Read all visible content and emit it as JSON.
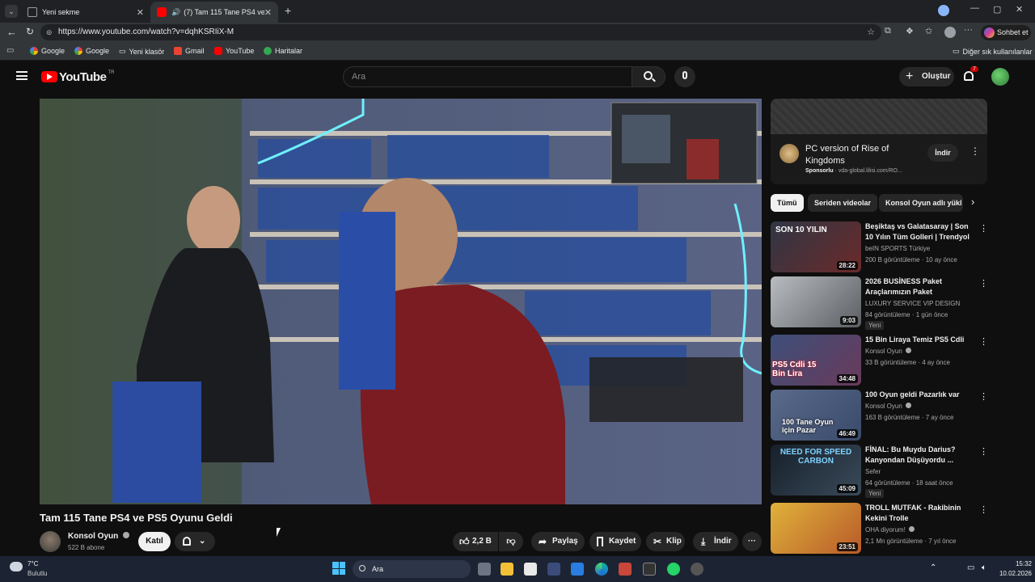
{
  "browser": {
    "tabs": [
      {
        "title": "Yeni sekme"
      },
      {
        "title": "(7) Tam 115 Tane PS4 ve PS5 O"
      }
    ],
    "url": "https://www.youtube.com/watch?v=dqhKSRIiX-M",
    "profile_button": "Sohbet et",
    "bookmarks": [
      "Google",
      "Google",
      "Yeni klasör",
      "Gmail",
      "YouTube",
      "Haritalar"
    ],
    "other_bookmarks": "Diğer sık kullanılanlar"
  },
  "youtube": {
    "logo": "YouTube",
    "logo_region": "TR",
    "search_placeholder": "Ara",
    "create_label": "Oluştur",
    "notification_count": "7"
  },
  "video": {
    "title": "Tam 115 Tane PS4 ve PS5 Oyunu Geldi",
    "channel": "Konsol Oyun",
    "subscribers": "522 B abone",
    "join_label": "Katıl",
    "likes": "2,2 B",
    "share_label": "Paylaş",
    "save_label": "Kaydet",
    "clip_label": "Klip",
    "download_label": "İndir"
  },
  "ad": {
    "title": "PC version of Rise of Kingdoms",
    "sponsored": "Sponsorlu",
    "domain": "· vda-global.lilisi.com/RO...",
    "button": "İndir"
  },
  "chips": [
    "Tümü",
    "Seriden videolar",
    "Konsol Oyun adlı yükl"
  ],
  "recommendations": [
    {
      "title": "Beşiktaş vs Galatasaray | Son 10 Yılın Tüm Golleri | Trendyol ...",
      "channel": "beIN SPORTS Türkiye",
      "meta": "200 B görüntüleme · 10 ay önce",
      "duration": "28:22",
      "badge": "",
      "thumb_color": "#3a3f4a",
      "thumb_text": "SON 10 YILIN"
    },
    {
      "title": "2026 BUSİNESS Paket Araçlarımızın Paket Kapsamla...",
      "channel": "LUXURY SERVICE VIP DESIGN",
      "meta": "84 görüntüleme · 1 gün önce",
      "duration": "9:03",
      "badge": "Yeni",
      "thumb_color": "#8a8d92",
      "thumb_text": ""
    },
    {
      "title": "15 Bin Liraya Temiz PS5 Cdli",
      "channel": "Konsol Oyun",
      "meta": "33 B görüntüleme · 4 ay önce",
      "duration": "34:48",
      "badge": "",
      "thumb_color": "#5a4a6a",
      "thumb_text": "PS5 Cdli 15 Bin Lira"
    },
    {
      "title": "100 Oyun geldi Pazarlık var",
      "channel": "Konsol Oyun",
      "meta": "163 B görüntüleme · 7 ay önce",
      "duration": "46:49",
      "badge": "",
      "thumb_color": "#4a5a7a",
      "thumb_text": "100 Tane Oyun için Pazar"
    },
    {
      "title": "FİNAL: Bu Muydu Darius? Kanyondan Düşüyordu ...",
      "channel": "Sefer",
      "meta": "64 görüntüleme · 18 saat önce",
      "duration": "45:09",
      "badge": "Yeni",
      "thumb_color": "#1f2a36",
      "thumb_text": "NEED FOR SPEED CARBON"
    },
    {
      "title": "TROLL MUTFAK - Rakibinin Kekini Trolle",
      "channel": "OHA diyorum!",
      "meta": "2,1 Mn görüntüleme · 7 yıl önce",
      "duration": "23:51",
      "badge": "",
      "thumb_color": "#c7a23a",
      "thumb_text": ""
    }
  ],
  "taskbar": {
    "weather_temp": "7°C",
    "weather_text": "Bulutlu",
    "search_label": "Ara",
    "time": "15:32",
    "date": "10.02.2026"
  }
}
